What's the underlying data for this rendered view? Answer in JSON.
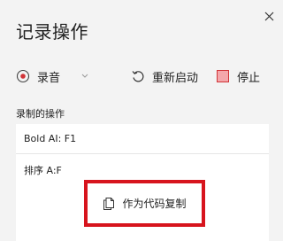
{
  "panel": {
    "title": "记录操作"
  },
  "toolbar": {
    "record_label": "录音",
    "restart_label": "重新启动",
    "stop_label": "停止"
  },
  "actions": {
    "section_label": "录制的操作",
    "items": [
      {
        "label": "Bold AI: F1"
      },
      {
        "label": "排序 A:F"
      }
    ]
  },
  "copy": {
    "label": "作为代码复制"
  },
  "colors": {
    "accent": "#d7141d",
    "stop_fill": "#f4a7ab",
    "stop_border": "#d13438"
  },
  "icons": {
    "close": "close-icon",
    "record": "record-icon",
    "restart": "restart-icon",
    "stop": "stop-icon",
    "copy": "copy-document-icon"
  }
}
